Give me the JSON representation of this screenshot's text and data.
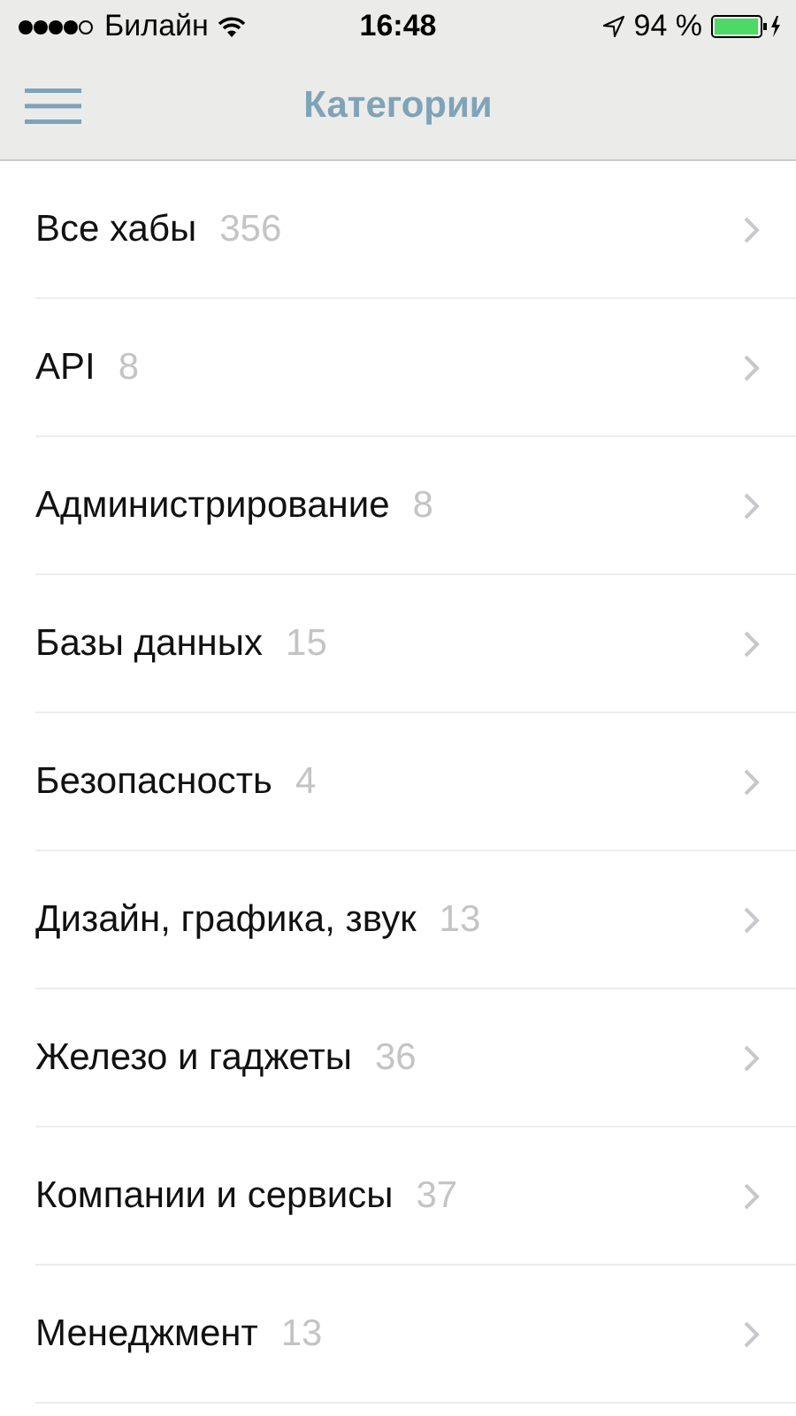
{
  "status_bar": {
    "carrier": "Билайн",
    "time": "16:48",
    "battery": "94 %"
  },
  "nav_bar": {
    "title": "Категории"
  },
  "categories": [
    {
      "name": "Все хабы",
      "count": "356"
    },
    {
      "name": "API",
      "count": "8"
    },
    {
      "name": "Администрирование",
      "count": "8"
    },
    {
      "name": "Базы данных",
      "count": "15"
    },
    {
      "name": "Безопасность",
      "count": "4"
    },
    {
      "name": "Дизайн, графика, звук",
      "count": "13"
    },
    {
      "name": "Железо и гаджеты",
      "count": "36"
    },
    {
      "name": "Компании и сервисы",
      "count": "37"
    },
    {
      "name": "Менеджмент",
      "count": "13"
    }
  ]
}
